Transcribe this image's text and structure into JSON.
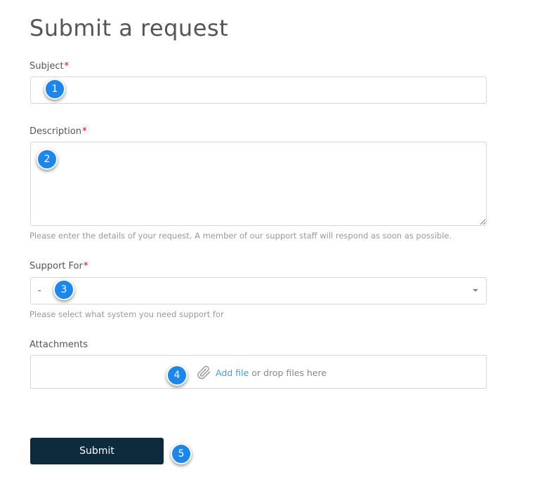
{
  "page": {
    "title": "Submit a request"
  },
  "form": {
    "subject": {
      "label": "Subject",
      "required_mark": "*",
      "value": ""
    },
    "description": {
      "label": "Description",
      "required_mark": "*",
      "value": "",
      "hint": "Please enter the details of your request. A member of our support staff will respond as soon as possible."
    },
    "support_for": {
      "label": "Support For",
      "required_mark": "*",
      "selected": "-",
      "hint": "Please select what system you need support for"
    },
    "attachments": {
      "label": "Attachments",
      "add_file_link": "Add file",
      "drop_text": "or drop files here",
      "icon": "paperclip-icon"
    },
    "submit_label": "Submit"
  },
  "markers": [
    "1",
    "2",
    "3",
    "4",
    "5"
  ],
  "colors": {
    "submit_bg": "#0e2a3d",
    "link": "#3aa3d8",
    "required": "#e0001b",
    "marker": "#1a86f0"
  }
}
